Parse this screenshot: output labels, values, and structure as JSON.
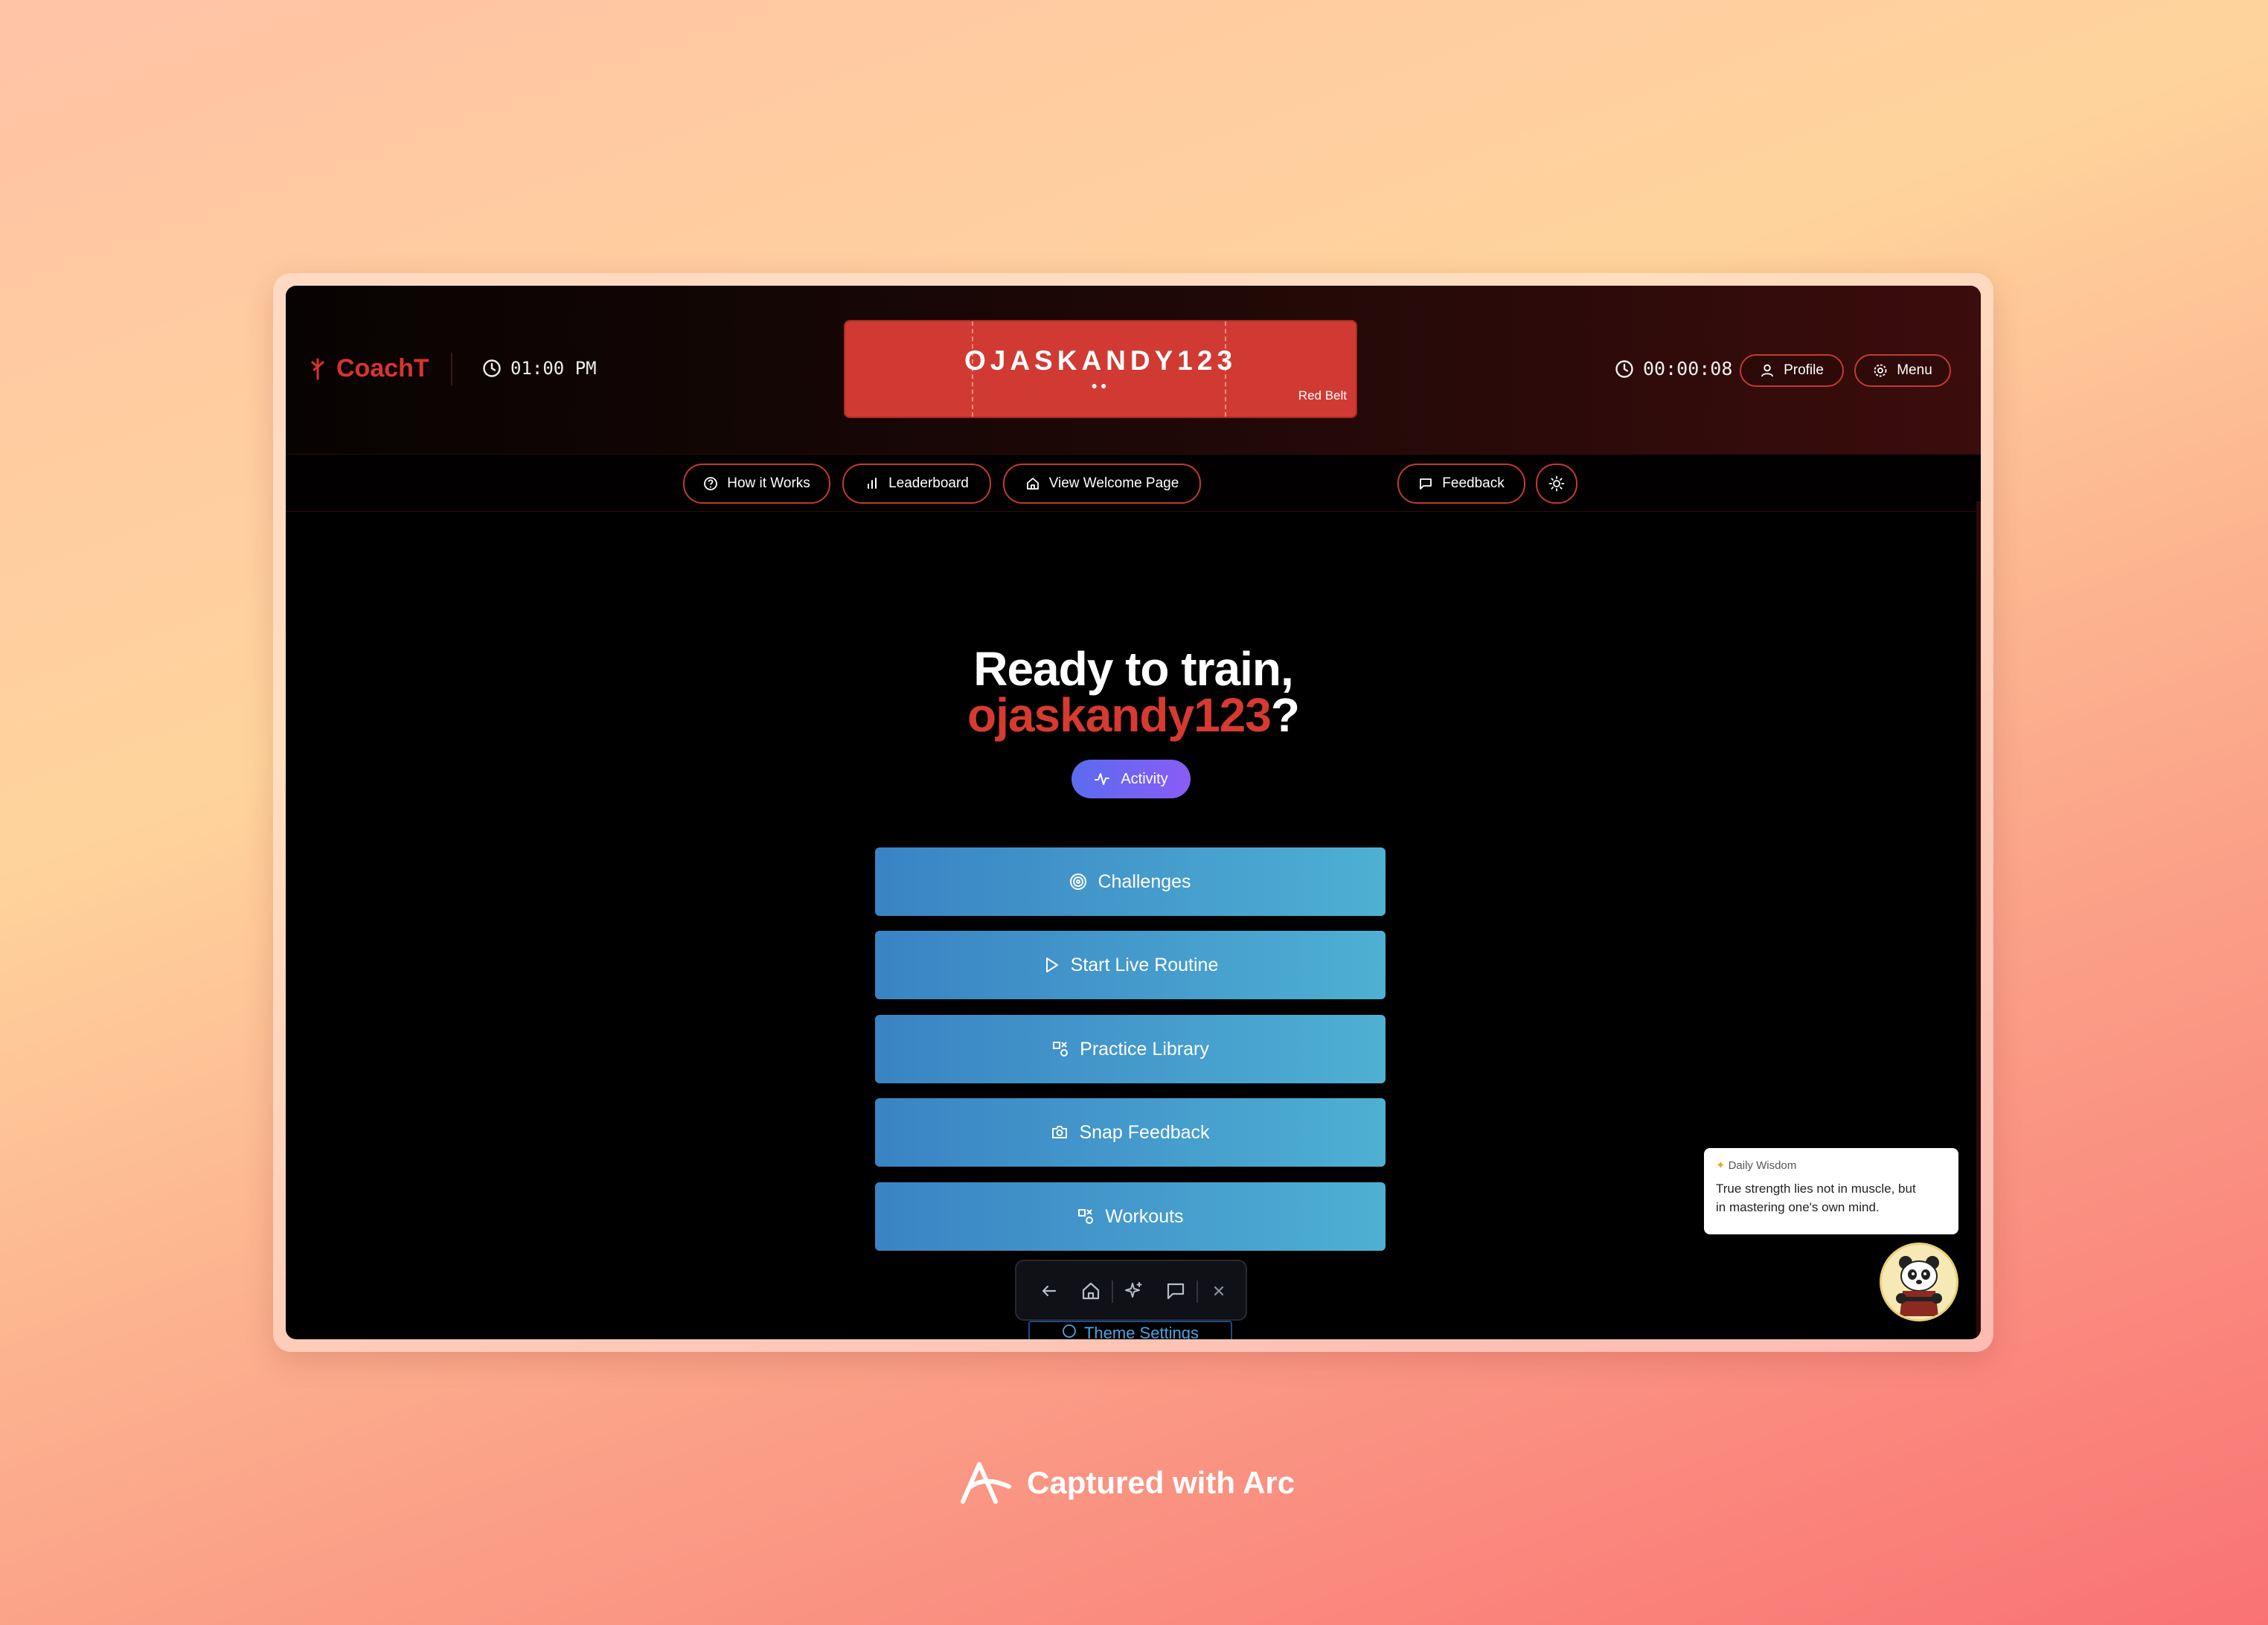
{
  "app": {
    "brand": "CoachT",
    "local_time": "01:00 PM",
    "user_banner": {
      "username": "OJASKANDY123",
      "dots": "●●",
      "belt": "Red Belt"
    },
    "session_timer": "00:00:08",
    "header_buttons": {
      "profile": "Profile",
      "menu": "Menu"
    }
  },
  "subnav": {
    "how_it_works": "How it Works",
    "leaderboard": "Leaderboard",
    "welcome": "View Welcome Page",
    "feedback": "Feedback"
  },
  "hero": {
    "line1": "Ready to train,",
    "username": "ojaskandy123",
    "punct": "?",
    "activity_label": "Activity"
  },
  "actions": [
    {
      "label": "Challenges",
      "icon": "target-icon"
    },
    {
      "label": "Start Live Routine",
      "icon": "play-icon"
    },
    {
      "label": "Practice Library",
      "icon": "shapes-icon"
    },
    {
      "label": "Snap Feedback",
      "icon": "camera-icon"
    },
    {
      "label": "Workouts",
      "icon": "shapes-icon"
    }
  ],
  "bottom_toolbar": {
    "icons": [
      "back-arrow-icon",
      "home-icon",
      "sparkles-icon",
      "chat-icon",
      "close-icon"
    ],
    "theme_settings": "Theme Settings"
  },
  "daily_wisdom": {
    "title": "Daily Wisdom",
    "line1": "True strength lies not in muscle, but",
    "line2": "in mastering one's own mind."
  },
  "capture_label": "Captured with Arc",
  "colors": {
    "accent_red": "#d13a33",
    "button_gradient_start": "#3a83c4",
    "button_gradient_end": "#4eb0d3",
    "activity_gradient_start": "#5a6cf0",
    "activity_gradient_end": "#8a5cf5"
  }
}
